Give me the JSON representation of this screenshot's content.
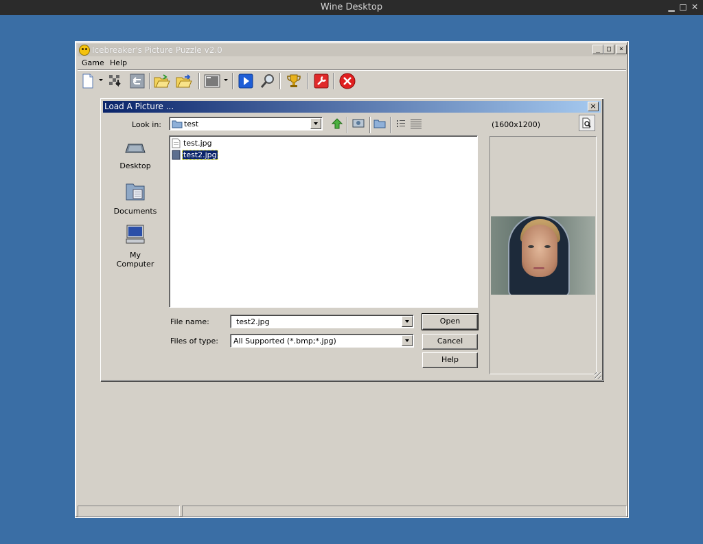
{
  "host": {
    "title": "Wine Desktop",
    "minimize": "▁",
    "maximize": "□",
    "close": "✕"
  },
  "app": {
    "title": "Icebreaker's Picture Puzzle v2.0",
    "controls": {
      "minimize": "_",
      "maximize": "□",
      "close": "×"
    },
    "menu": [
      {
        "label": "Game"
      },
      {
        "label": "Help"
      }
    ]
  },
  "toolbar": {
    "icons": [
      "new-game-icon",
      "shuffle-icon",
      "undo-icon",
      "open-folder-icon",
      "open-folder-next-icon",
      "picture-select-icon",
      "play-icon",
      "zoom-icon",
      "trophy-icon",
      "settings-wrench-icon",
      "exit-icon"
    ]
  },
  "dialog": {
    "title": "Load A Picture ...",
    "close": "×",
    "look_in_label": "Look in:",
    "look_in_value": "test",
    "preview_size": "(1600x1200)",
    "places": [
      {
        "label": "Desktop"
      },
      {
        "label": "Documents"
      },
      {
        "label": "My Computer"
      }
    ],
    "files": [
      {
        "name": "test.jpg",
        "selected": false
      },
      {
        "name": "test2.jpg",
        "selected": true
      }
    ],
    "file_name_label": "File name:",
    "file_name_value": "test2.jpg",
    "file_type_label": "Files of type:",
    "file_type_value": "All Supported (*.bmp;*.jpg)",
    "buttons": {
      "open": "Open",
      "cancel": "Cancel",
      "help": "Help"
    }
  }
}
